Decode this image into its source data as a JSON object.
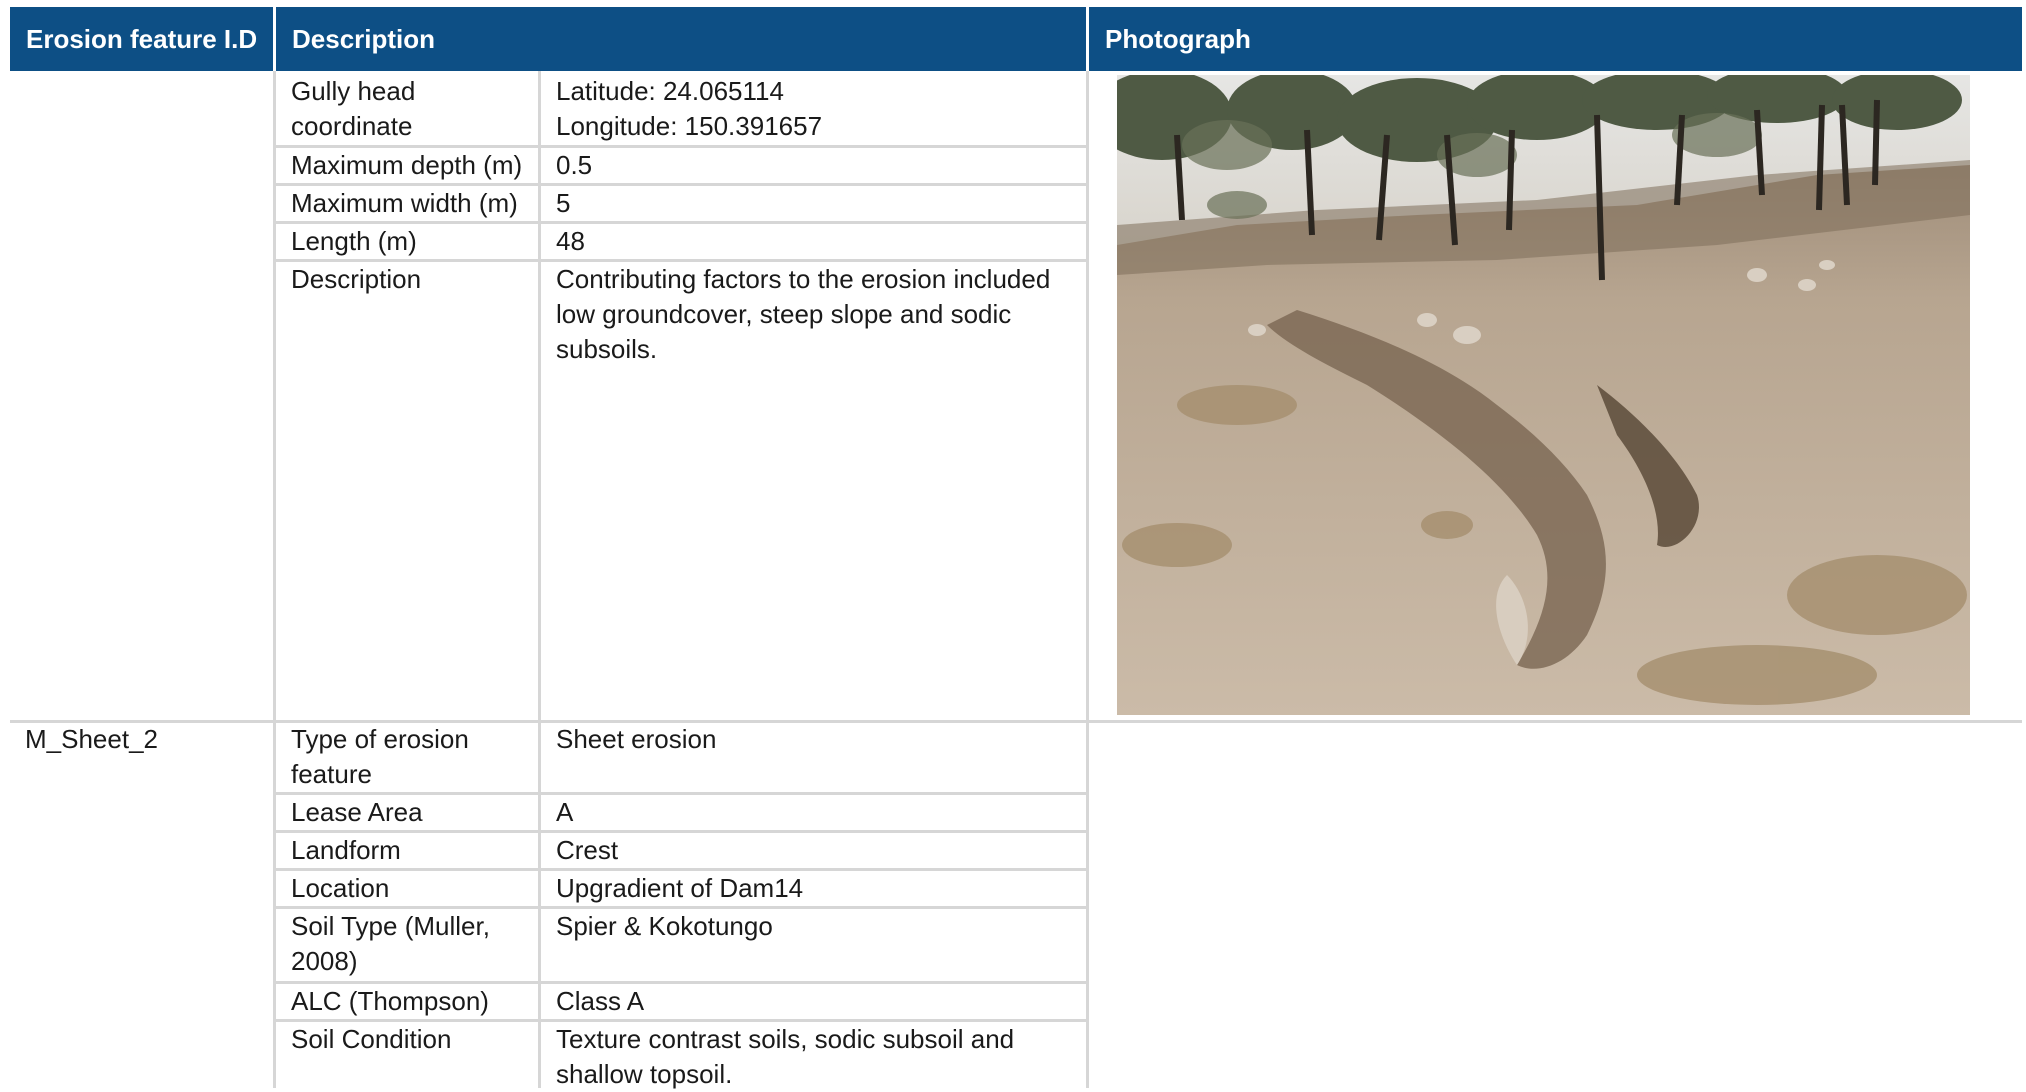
{
  "table": {
    "headers": {
      "id": "Erosion feature I.D",
      "description": "Description",
      "photograph": "Photograph"
    },
    "record1": {
      "rows": [
        {
          "label": "Gully head\ncoordinate",
          "value": "Latitude: 24.065114\nLongitude: 150.391657"
        },
        {
          "label": "Maximum depth (m)",
          "value": "0.5"
        },
        {
          "label": "Maximum width (m)",
          "value": "5"
        },
        {
          "label": "Length (m)",
          "value": "48"
        },
        {
          "label": "Description",
          "value": "Contributing factors to the erosion included\nlow groundcover, steep slope and sodic\nsubsoils."
        }
      ],
      "photo_icon": "gully-erosion-photo"
    },
    "record2": {
      "id": "M_Sheet_2",
      "rows": [
        {
          "label": "Type of erosion\nfeature",
          "value": "Sheet erosion"
        },
        {
          "label": "Lease Area",
          "value": "A"
        },
        {
          "label": "Landform",
          "value": "Crest"
        },
        {
          "label": "Location",
          "value": "Upgradient of Dam14"
        },
        {
          "label": "Soil Type (Muller,\n2008)",
          "value": "Spier & Kokotungo"
        },
        {
          "label": "ALC (Thompson)",
          "value": "Class A"
        },
        {
          "label": "Soil Condition",
          "value": "Texture contrast soils, sodic subsoil and\nshallow topsoil."
        }
      ]
    },
    "colors": {
      "header_bg": "#0d4f85",
      "header_text": "#ffffff",
      "grid": "#d6d6d6"
    }
  }
}
